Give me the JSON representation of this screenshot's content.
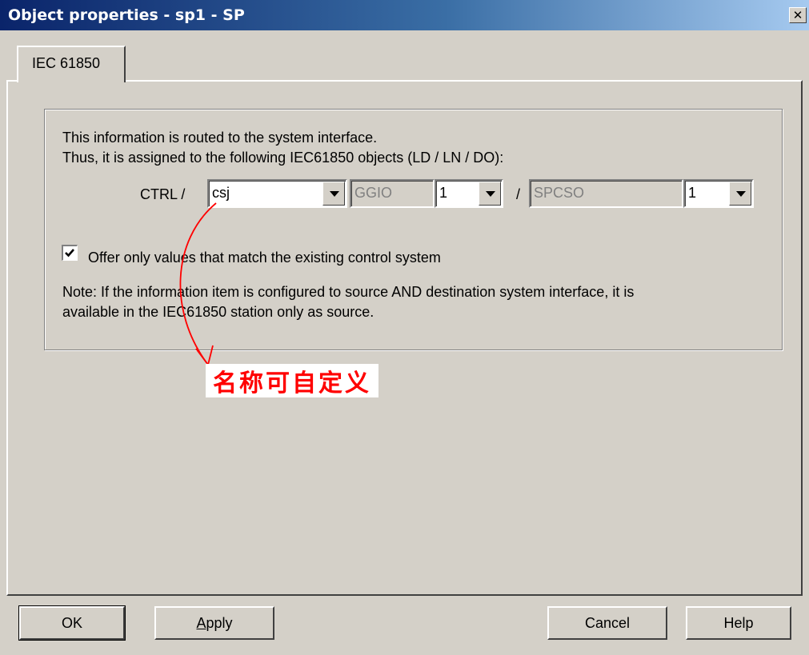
{
  "window": {
    "title": "Object properties - sp1 - SP",
    "close_glyph": "✕"
  },
  "tabs": [
    {
      "label": "IEC 61850",
      "active": true
    }
  ],
  "group": {
    "line1": "This information is routed to the system interface.",
    "line2": "Thus, it is assigned to the following IEC61850 objects (LD / LN / DO):",
    "ld_prefix": "CTRL /",
    "combo_ld": "csj",
    "combo_ln": "GGIO",
    "combo_ln_inst": "1",
    "separator": "/",
    "combo_do": "SPCSO",
    "combo_do_inst": "1",
    "checkbox_checked": true,
    "checkbox_label": "Offer only values that match the existing control system",
    "note_line1": "Note: If the information item is configured to source AND destination system interface, it is",
    "note_line2": "available in the IEC61850 station only as source."
  },
  "annotation": {
    "text": "名称可自定义",
    "color": "#ff0000"
  },
  "buttons": {
    "ok": "OK",
    "apply_mnemonic": "A",
    "apply_rest": "pply",
    "cancel": "Cancel",
    "help": "Help"
  },
  "colors": {
    "titlebar_start": "#0a246a",
    "titlebar_end": "#a6caf0",
    "face": "#d4d0c8"
  }
}
